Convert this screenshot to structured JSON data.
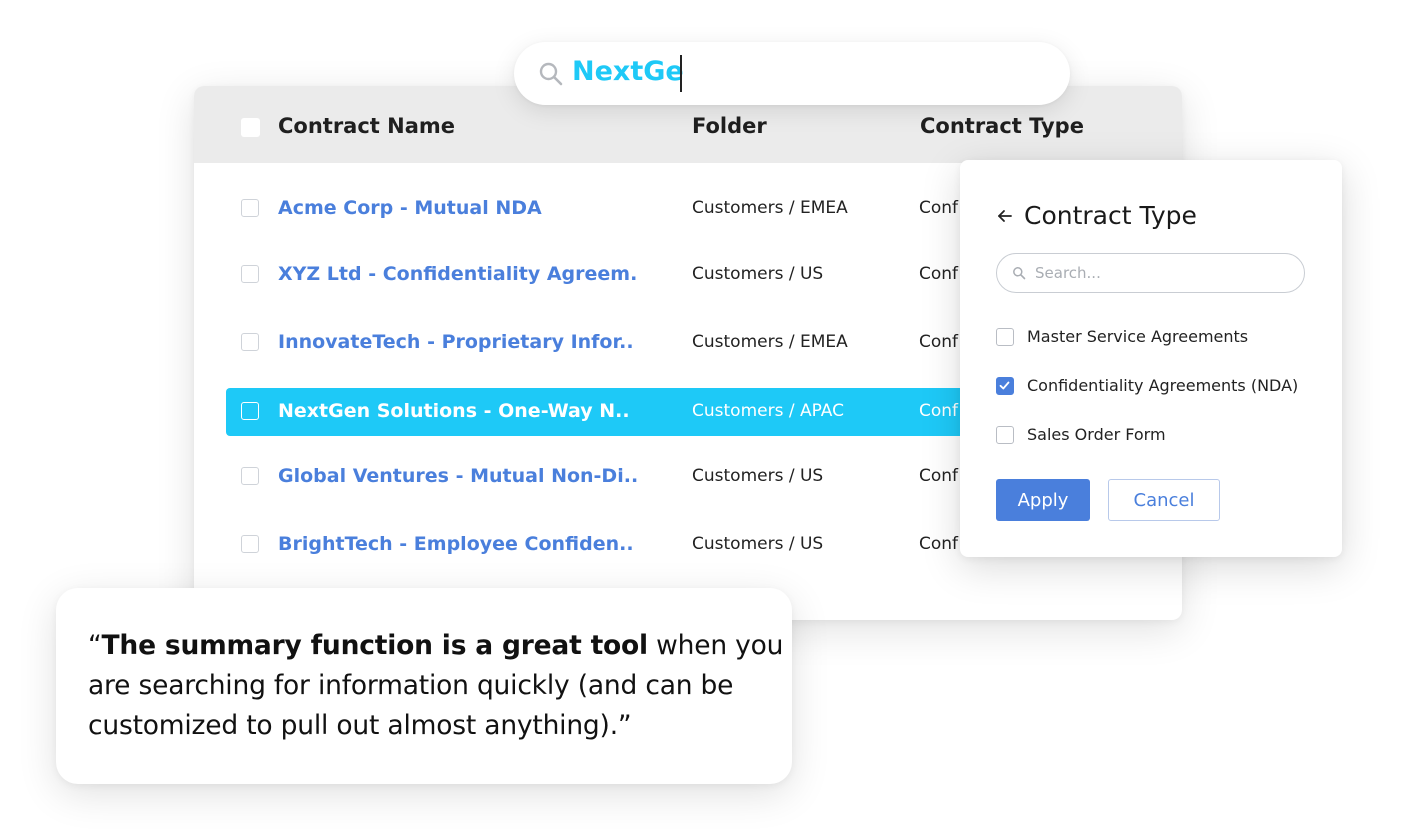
{
  "search": {
    "query": "NextGe"
  },
  "table": {
    "columns": [
      "Contract Name",
      "Folder",
      "Contract Type"
    ],
    "rows": [
      {
        "name": "Acme Corp - Mutual NDA",
        "folder": "Customers / EMEA",
        "type": "Conf"
      },
      {
        "name": "XYZ Ltd - Confidentiality Agreem..",
        "folder": "Customers / US",
        "type": "Conf"
      },
      {
        "name": "InnovateTech - Proprietary Infor..",
        "folder": "Customers / EMEA",
        "type": "Conf"
      },
      {
        "name": "NextGen Solutions - One-Way N..",
        "folder": "Customers / APAC",
        "type": "Conf",
        "selected": true
      },
      {
        "name": "Global Ventures - Mutual Non-Di..",
        "folder": "Customers / US",
        "type": "Conf"
      },
      {
        "name": "BrightTech - Employee Confiden..",
        "folder": "Customers / US",
        "type": "Conf"
      }
    ]
  },
  "filter_panel": {
    "title": "Contract Type",
    "search_placeholder": "Search...",
    "options": [
      {
        "label": "Master Service Agreements",
        "checked": false
      },
      {
        "label": "Confidentiality Agreements (NDA)",
        "checked": true
      },
      {
        "label": "Sales Order Form",
        "checked": false
      }
    ],
    "apply_label": "Apply",
    "cancel_label": "Cancel"
  },
  "testimonial": {
    "open_quote": "“",
    "bold": "The summary function is a great tool",
    "rest": " when you are searching for information quickly (and can be customized to pull out almost anything).”"
  },
  "colors": {
    "accent": "#1ec9f7",
    "link_blue": "#4a7fdc",
    "header_bg": "#ebebeb"
  }
}
